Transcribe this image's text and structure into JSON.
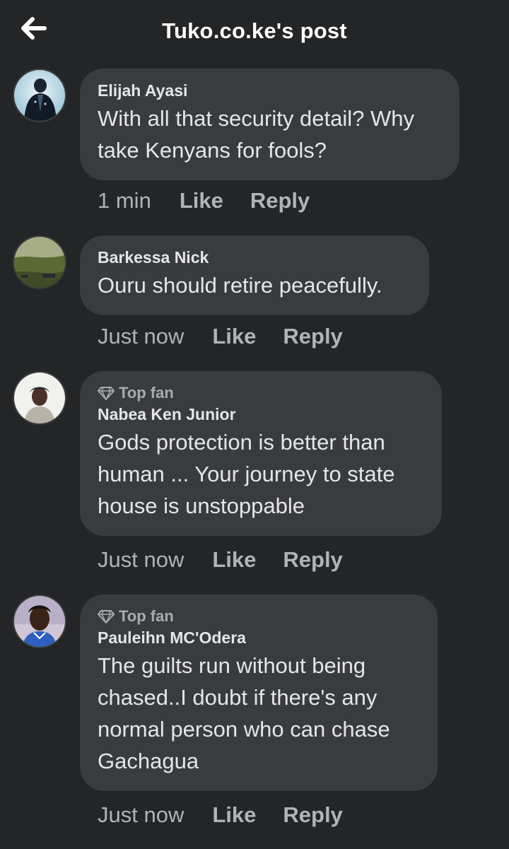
{
  "header": {
    "title": "Tuko.co.ke's post",
    "back_icon": "arrow-left-icon"
  },
  "comments": [
    {
      "author": "Elijah Ayasi",
      "top_fan": false,
      "text": "With all that security detail? Why take Kenyans for fools?",
      "time": "1 min",
      "like_label": "Like",
      "reply_label": "Reply"
    },
    {
      "author": "Barkessa Nick",
      "top_fan": false,
      "text": "Ouru should retire peacefully.",
      "time": "Just now",
      "like_label": "Like",
      "reply_label": "Reply"
    },
    {
      "author": "Nabea Ken Junior",
      "top_fan": true,
      "badge": "Top fan",
      "text": "Gods protection is better than human ... Your journey to state house is unstoppable",
      "time": "Just now",
      "like_label": "Like",
      "reply_label": "Reply"
    },
    {
      "author": "Pauleihn MC'Odera",
      "top_fan": true,
      "badge": "Top fan",
      "text": "The guilts run without being chased..I doubt if there's any normal person who can chase Gachagua",
      "time": "Just now",
      "like_label": "Like",
      "reply_label": "Reply"
    }
  ],
  "colors": {
    "background": "#242526",
    "bubble": "#3a3b3c",
    "text_primary": "#e4e6eb",
    "text_secondary": "#b0b3b8"
  }
}
